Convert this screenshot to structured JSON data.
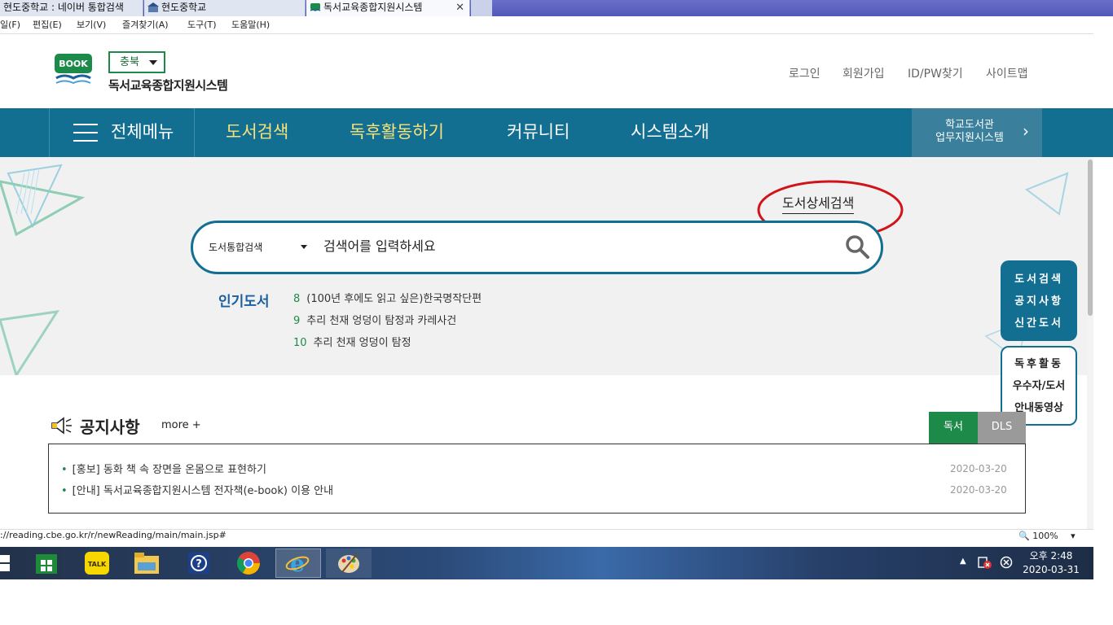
{
  "browser": {
    "tabs": [
      {
        "label": "현도중학교 : 네이버 통합검색"
      },
      {
        "label": "현도중학교"
      },
      {
        "label": "독서교육종합지원시스템",
        "active": true
      }
    ],
    "close_label": "✕",
    "menu": [
      "일(F)",
      "편집(E)",
      "보기(V)",
      "즐겨찾기(A)",
      "도구(T)",
      "도움말(H)"
    ],
    "status_url": "://reading.cbe.go.kr/r/newReading/main/main.jsp#",
    "zoom": "100%"
  },
  "header": {
    "logo_text": "BOOK",
    "region": "충북",
    "site_title": "독서교육종합지원시스템",
    "links": [
      "로그인",
      "회원가입",
      "ID/PW찾기",
      "사이트맵"
    ]
  },
  "nav": {
    "all_menu": "전체메뉴",
    "items": [
      "도서검색",
      "독후활동하기",
      "커뮤니티",
      "시스템소개"
    ],
    "lib_line1": "학교도서관",
    "lib_line2": "업무지원시스템",
    "lib_arrow": "›"
  },
  "search": {
    "advanced_label": "도서상세검색",
    "type_label": "도서통합검색",
    "placeholder": "검색어를 입력하세요"
  },
  "popular": {
    "title": "인기도서",
    "items": [
      {
        "rank": "8",
        "title": "(100년 후에도 읽고 싶은)한국명작단편"
      },
      {
        "rank": "9",
        "title": "추리 천재 엉덩이 탐정과 카레사건"
      },
      {
        "rank": "10",
        "title": "추리 천재 엉덩이 탐정"
      }
    ]
  },
  "quick_menu": {
    "group1": [
      "도서검색",
      "공지사항",
      "신간도서"
    ],
    "group2": [
      "독후활동",
      "우수자/도서",
      "안내동영상"
    ]
  },
  "notice": {
    "title": "공지사항",
    "more": "more +",
    "tabs": [
      "독서",
      "DLS"
    ],
    "items": [
      {
        "text": "[홍보] 동화 책 속 장면을 온몸으로 표현하기",
        "date": "2020-03-20"
      },
      {
        "text": "[안내] 독서교육종합지원시스템 전자책(e-book) 이용 안내",
        "date": "2020-03-20"
      }
    ]
  },
  "taskbar": {
    "time": "오후 2:48",
    "date": "2020-03-31",
    "talk_label": "TALK"
  },
  "colors": {
    "nav_bg": "#136f92",
    "nav_active_text": "#f5e37a",
    "accent_green": "#1e8a4a",
    "annotation_red": "#d0141a"
  }
}
